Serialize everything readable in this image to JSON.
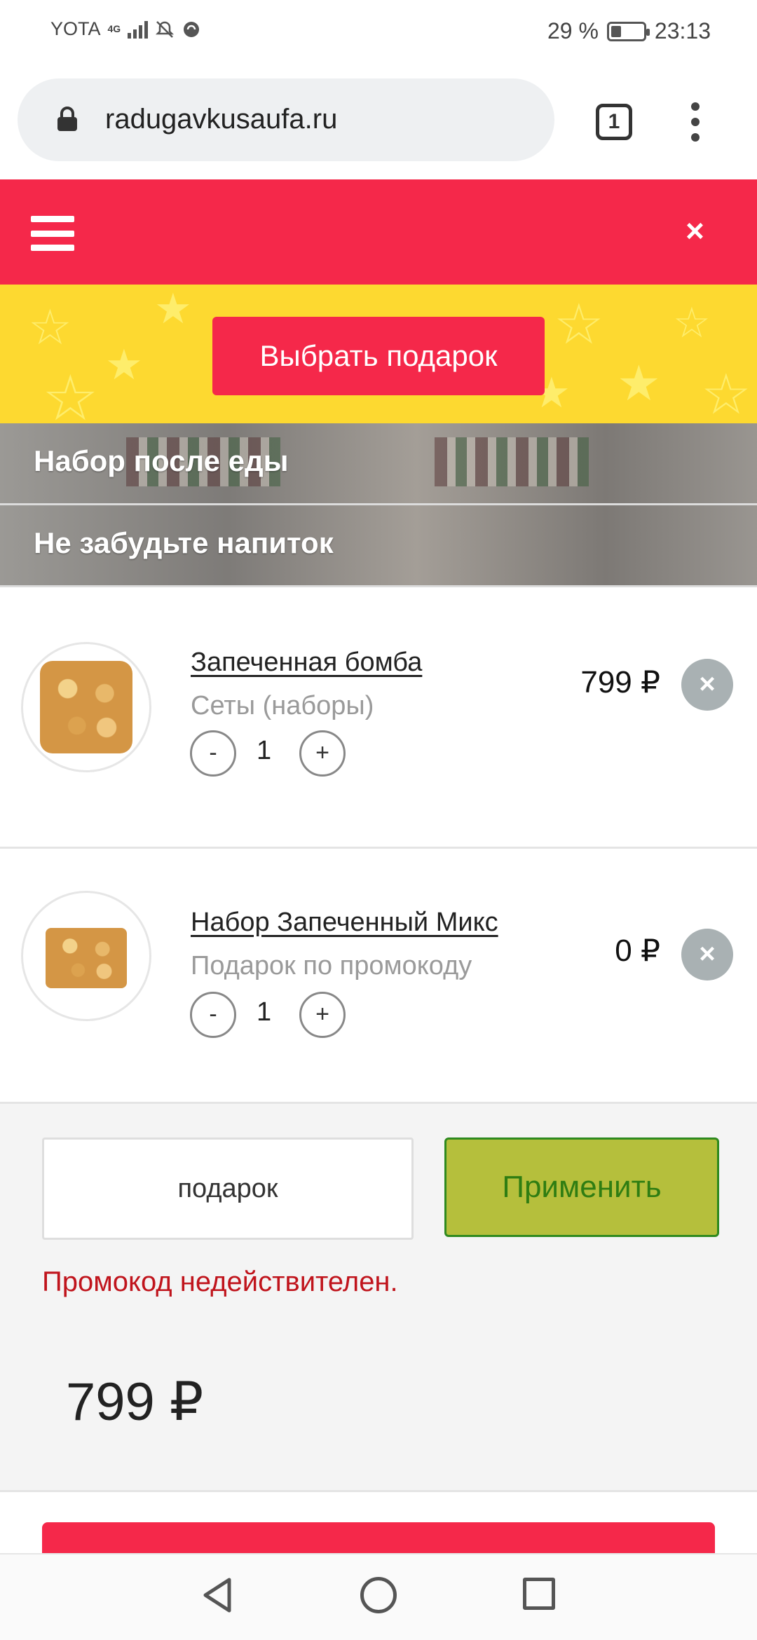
{
  "status_bar": {
    "carrier": "YOTA",
    "network": "4G",
    "battery_percent": "29 %",
    "battery_level": 0.29,
    "time": "23:13"
  },
  "browser": {
    "url": "radugavkusaufa.ru",
    "tab_count": "1"
  },
  "header": {
    "close_label": "×"
  },
  "gift_banner": {
    "button_label": "Выбрать подарок"
  },
  "categories": [
    {
      "label": "Набор после еды"
    },
    {
      "label": "Не забудьте напиток"
    }
  ],
  "cart": {
    "items": [
      {
        "name": "Запеченная бомба",
        "category": "Сеты (наборы)",
        "quantity": "1",
        "price": "799 ₽"
      },
      {
        "name": "Набор Запеченный Микс",
        "category": "Подарок по промокоду",
        "quantity": "1",
        "price": "0 ₽"
      }
    ],
    "minus_label": "-",
    "plus_label": "+",
    "remove_label": "×"
  },
  "promo": {
    "input_value": "подарок",
    "apply_label": "Применить",
    "error_text": "Промокод недействителен.",
    "total": "799 ₽"
  },
  "colors": {
    "brand_red": "#f5284a",
    "banner_yellow": "#fdd930",
    "apply_green": "#b5bf3c",
    "error_red": "#c0141c"
  }
}
